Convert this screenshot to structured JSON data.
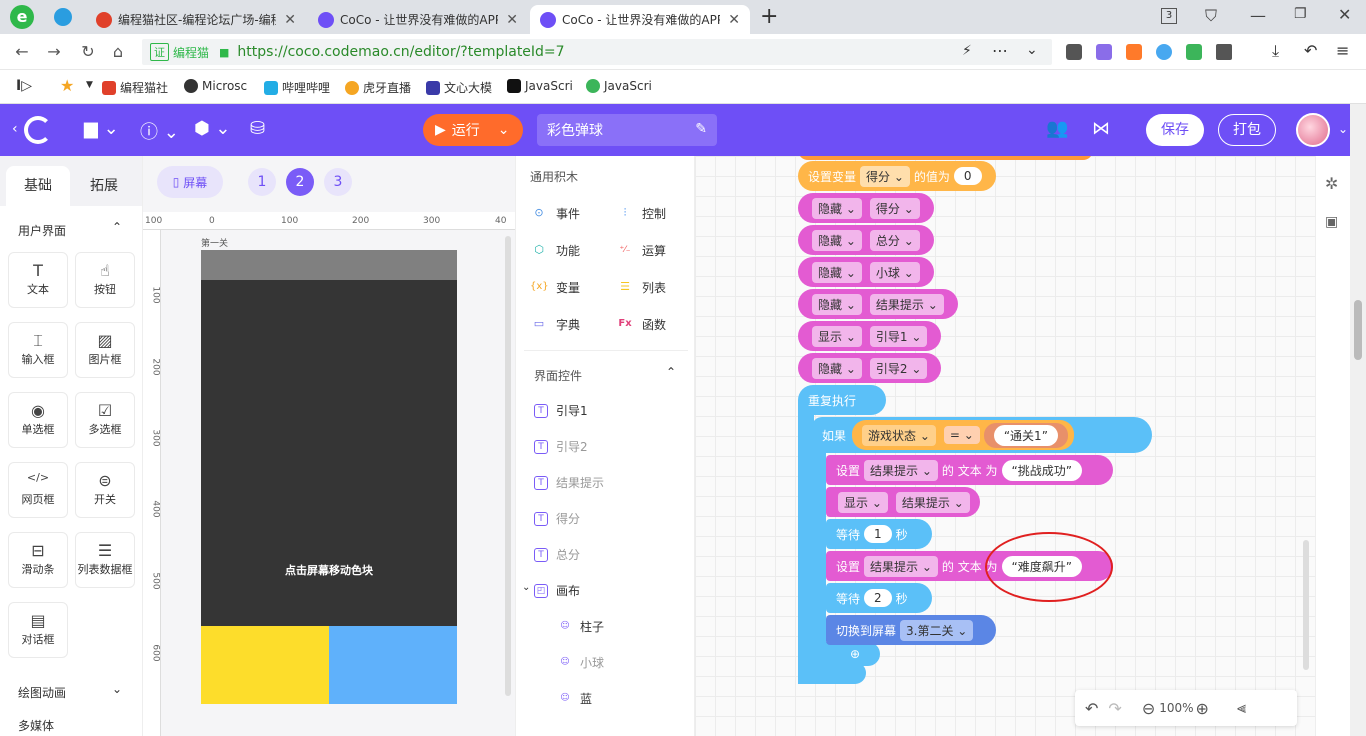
{
  "browser": {
    "tabs": [
      {
        "title": "编程猫社区-编程论坛广场-编程"
      },
      {
        "title": "CoCo - 让世界没有难做的APP"
      },
      {
        "title": "CoCo - 让世界没有难做的APP"
      }
    ],
    "new_tab": "+",
    "tab_count": "3",
    "url_site": "编程猫",
    "url": "https://coco.codemao.cn/editor/?templateId=7",
    "bookmarks": [
      "编程猫社",
      "Microsc",
      "哔哩哔哩",
      "虎牙直播",
      "文心大模",
      "JavaScri",
      "JavaScri"
    ]
  },
  "app": {
    "run_label": "运行",
    "project_name": "彩色弹球",
    "save_label": "保存",
    "pack_label": "打包"
  },
  "left_panel": {
    "tabs": [
      "基础",
      "拓展"
    ],
    "section_ui": "用户界面",
    "widgets": [
      {
        "label": "文本",
        "icon": "T"
      },
      {
        "label": "按钮",
        "icon": "☝"
      },
      {
        "label": "输入框",
        "icon": "⌶"
      },
      {
        "label": "图片框",
        "icon": "▨"
      },
      {
        "label": "单选框",
        "icon": "◉"
      },
      {
        "label": "多选框",
        "icon": "☑"
      },
      {
        "label": "网页框",
        "icon": "</>"
      },
      {
        "label": "开关",
        "icon": "⊜"
      },
      {
        "label": "滑动条",
        "icon": "⊟"
      },
      {
        "label": "列表数据框",
        "icon": "☰"
      },
      {
        "label": "对话框",
        "icon": "▤"
      }
    ],
    "section_draw": "绘图动画",
    "section_media": "多媒体"
  },
  "stage": {
    "screen_button": "屏幕",
    "pages": [
      "1",
      "2",
      "3"
    ],
    "ruler_h": [
      "100",
      "0",
      "100",
      "200",
      "300",
      "40"
    ],
    "ruler_v": [
      "100",
      "200",
      "300",
      "400",
      "500",
      "600"
    ],
    "screen_name": "第一关",
    "phone_text": "点击屏幕移动色块"
  },
  "block_panel": {
    "common_title": "通用积木",
    "categories": [
      {
        "label": "事件",
        "icon": "⊙",
        "color": "#4a90e2"
      },
      {
        "label": "控制",
        "icon": "⫶",
        "color": "#2f80ed"
      },
      {
        "label": "功能",
        "icon": "⬡",
        "color": "#20b2aa"
      },
      {
        "label": "运算",
        "icon": "⁺⁄₋",
        "color": "#f05a5a"
      },
      {
        "label": "变量",
        "icon": "{x}",
        "color": "#f5a623"
      },
      {
        "label": "列表",
        "icon": "☰",
        "color": "#f5c623"
      },
      {
        "label": "字典",
        "icon": "📖",
        "color": "#6a6ae8"
      },
      {
        "label": "函数",
        "icon": "Fx",
        "color": "#e0407a"
      }
    ],
    "controls_title": "界面控件",
    "controls": [
      "引导1",
      "引导2",
      "结果提示",
      "得分",
      "总分"
    ],
    "canvas_label": "画布",
    "canvas_children": [
      "柱子",
      "小球",
      "蓝"
    ]
  },
  "blocks": {
    "set_var": {
      "label": "设置变量",
      "var": "得分",
      "mid": "的值为",
      "value": "0"
    },
    "rows": [
      {
        "action": "隐藏",
        "target": "得分"
      },
      {
        "action": "隐藏",
        "target": "总分"
      },
      {
        "action": "隐藏",
        "target": "小球"
      },
      {
        "action": "隐藏",
        "target": "结果提示"
      },
      {
        "action": "显示",
        "target": "引导1"
      },
      {
        "action": "隐藏",
        "target": "引导2"
      }
    ],
    "repeat": "重复执行",
    "if_label": "如果",
    "if_var": "游戏状态",
    "if_op": "=",
    "if_value": "“通关1”",
    "set_text1": {
      "label": "设置",
      "target": "结果提示",
      "mid": "的 文本 为",
      "value": "“挑战成功”"
    },
    "show": {
      "action": "显示",
      "target": "结果提示"
    },
    "wait1": {
      "label": "等待",
      "value": "1",
      "unit": "秒"
    },
    "set_text2": {
      "label": "设置",
      "target": "结果提示",
      "mid": "的 文本 为",
      "value": "“难度飙升”"
    },
    "wait2": {
      "label": "等待",
      "value": "2",
      "unit": "秒"
    },
    "switch": {
      "label": "切换到屏幕",
      "value": "3.第二关"
    }
  },
  "zoom": {
    "level": "100%"
  }
}
